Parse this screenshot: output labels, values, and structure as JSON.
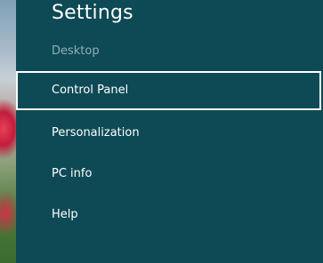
{
  "settings": {
    "title": "Settings",
    "section": "Desktop",
    "items": [
      {
        "label": "Control Panel",
        "focused": true
      },
      {
        "label": "Personalization",
        "focused": false
      },
      {
        "label": "PC info",
        "focused": false
      },
      {
        "label": "Help",
        "focused": false
      }
    ]
  },
  "colors": {
    "panel_background": "#0e4a55",
    "focus_border": "#ffffff",
    "section_label": "#8fb0b6"
  }
}
